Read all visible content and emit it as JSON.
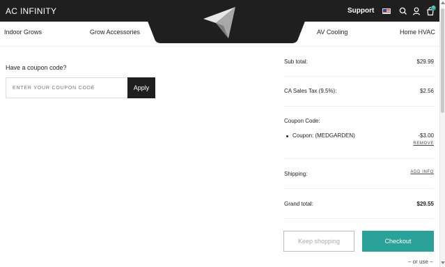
{
  "header": {
    "brand": "AC INFINITY",
    "support_label": "Support",
    "icons": [
      "us-flag-icon",
      "search-icon",
      "account-icon",
      "cart-icon"
    ],
    "cart_count": "0"
  },
  "nav": {
    "items": [
      "Indoor Grows",
      "Grow Accessories",
      "AV Cooling",
      "Home HVAC"
    ]
  },
  "coupon": {
    "question": "Have a coupon code?",
    "placeholder": "ENTER YOUR COUPON CODE",
    "apply_label": "Apply"
  },
  "summary": {
    "subtotal_label": "Sub total:",
    "subtotal_value": "$29.99",
    "tax_label": "CA Sales Tax (9.5%):",
    "tax_value": "$2.56",
    "coupon_code_label": "Coupon Code:",
    "coupon_line_label": "Coupon: (MEDGARDEN)",
    "coupon_line_value": "-$3.00",
    "remove_label": "REMOVE",
    "shipping_label": "Shipping:",
    "add_info_label": "ADD INFO",
    "grand_total_label": "Grand total:",
    "grand_total_value": "$29.55"
  },
  "actions": {
    "keep_shopping_label": "Keep shopping",
    "checkout_label": "Checkout",
    "or_use_label": "– or use –"
  },
  "colors": {
    "header_bg": "#1f1f1f",
    "accent": "#2aa199"
  }
}
